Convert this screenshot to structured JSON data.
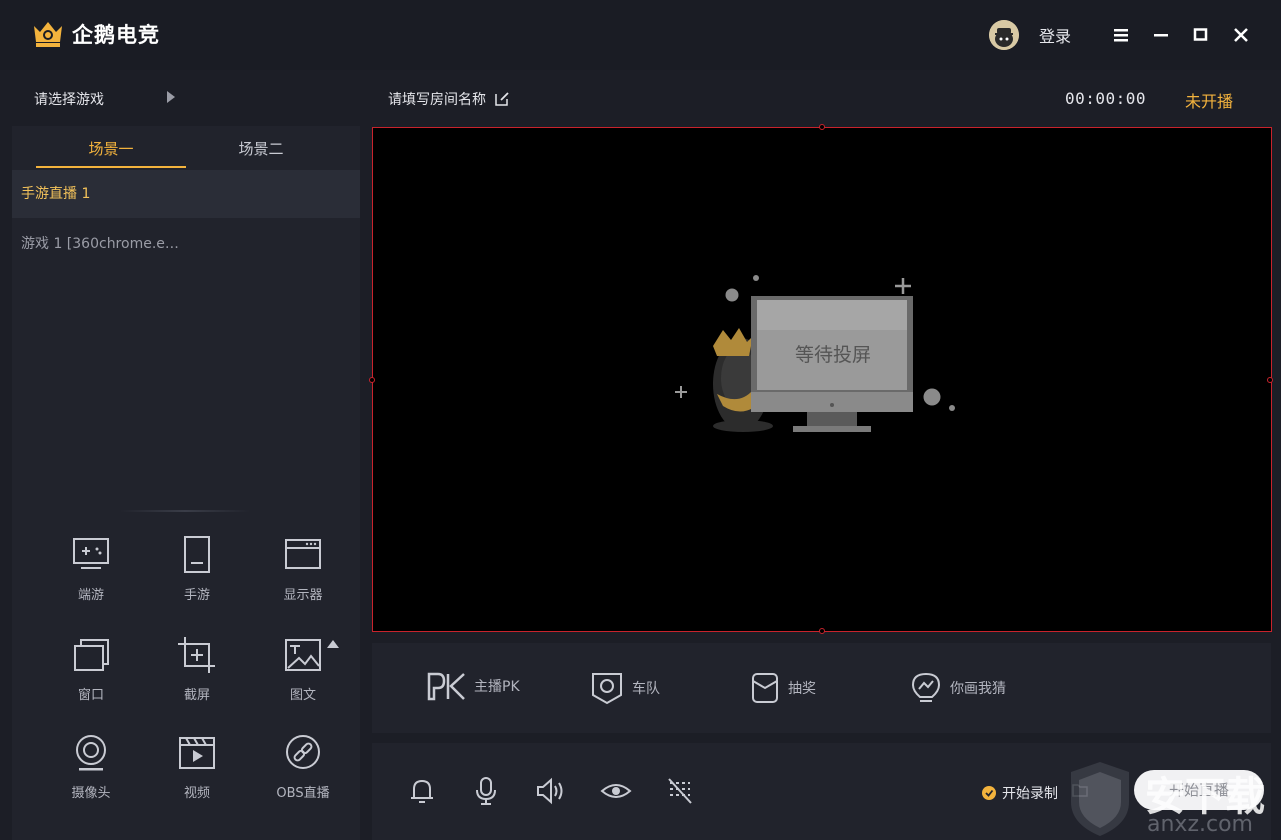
{
  "app": {
    "name": "企鹅电竞",
    "login_label": "登录"
  },
  "subbar": {
    "game_select": "请选择游戏",
    "room_name_placeholder": "请填写房间名称",
    "timer": "00:00:00",
    "live_status": "未开播"
  },
  "scenes": {
    "tabs": [
      "场景一",
      "场景二"
    ],
    "active_tab": 0,
    "items": [
      "手游直播 1",
      "游戏 1 [360chrome.e…"
    ]
  },
  "sources": [
    {
      "label": "端游",
      "icon": "pc-game-icon"
    },
    {
      "label": "手游",
      "icon": "mobile-game-icon"
    },
    {
      "label": "显示器",
      "icon": "monitor-icon"
    },
    {
      "label": "窗口",
      "icon": "window-icon"
    },
    {
      "label": "截屏",
      "icon": "screenshot-icon"
    },
    {
      "label": "图文",
      "icon": "image-text-icon"
    },
    {
      "label": "摄像头",
      "icon": "camera-icon"
    },
    {
      "label": "视频",
      "icon": "video-icon"
    },
    {
      "label": "OBS直播",
      "icon": "obs-link-icon"
    }
  ],
  "preview": {
    "waiting_text": "等待投屏"
  },
  "features": [
    {
      "label": "主播PK",
      "icon": "pk-icon"
    },
    {
      "label": "车队",
      "icon": "team-icon"
    },
    {
      "label": "抽奖",
      "icon": "lottery-icon"
    },
    {
      "label": "你画我猜",
      "icon": "draw-guess-icon"
    }
  ],
  "controls": {
    "record_label": "开始录制",
    "start_live_label": "开始直播"
  },
  "watermark": {
    "text": "安下载",
    "sub": "anxz.com"
  },
  "colors": {
    "accent": "#f3b33d",
    "preview_border": "#c8232c",
    "panel_bg": "#21232c",
    "page_bg": "#1c1e26"
  }
}
